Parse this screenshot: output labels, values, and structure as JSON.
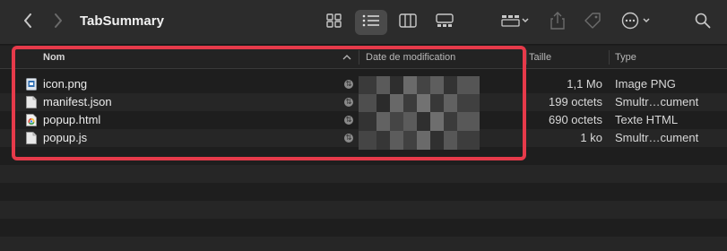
{
  "window": {
    "title": "TabSummary"
  },
  "toolbar": {
    "back_icon": "chevron-left-icon",
    "forward_icon": "chevron-right-icon",
    "views": [
      "icon-view",
      "list-view",
      "column-view",
      "gallery-view"
    ],
    "active_view": "list-view"
  },
  "columns": {
    "name": "Nom",
    "date": "Date de modification",
    "size": "Taille",
    "kind": "Type"
  },
  "files": [
    {
      "name": "icon.png",
      "size": "1,1 Mo",
      "kind": "Image PNG",
      "icon": "png-file-icon"
    },
    {
      "name": "manifest.json",
      "size": "199 octets",
      "kind": "Smultr…cument",
      "icon": "json-file-icon"
    },
    {
      "name": "popup.html",
      "size": "690 octets",
      "kind": "Texte HTML",
      "icon": "html-file-icon"
    },
    {
      "name": "popup.js",
      "size": "1 ko",
      "kind": "Smultr…cument",
      "icon": "js-file-icon"
    }
  ],
  "colors": {
    "highlight": "#e63a4a",
    "background": "#1e1e1e",
    "toolbar": "#2c2c2c"
  }
}
